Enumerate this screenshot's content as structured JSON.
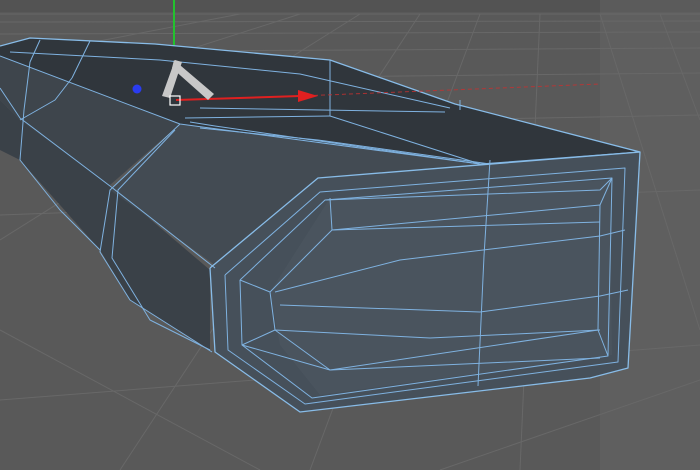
{
  "viewport": {
    "kind": "3d-perspective-view",
    "background_color": "#5a5a5a",
    "grid_line_color": "#656565",
    "horizon_color": "#555555"
  },
  "mesh": {
    "object": "beveled-box",
    "selection_edge_color": "#7fb2e0",
    "face_color_top": "#2f3439",
    "face_color_side": "#3b4249",
    "face_color_end": "#47505a"
  },
  "axes": {
    "x_axis_color": "#e02020",
    "y_axis_color": "#22c22e",
    "z_axis_color": "#2a3cf0",
    "manipulator_icon": "move-tool-icon",
    "handle_color": "#c8c8c8"
  }
}
